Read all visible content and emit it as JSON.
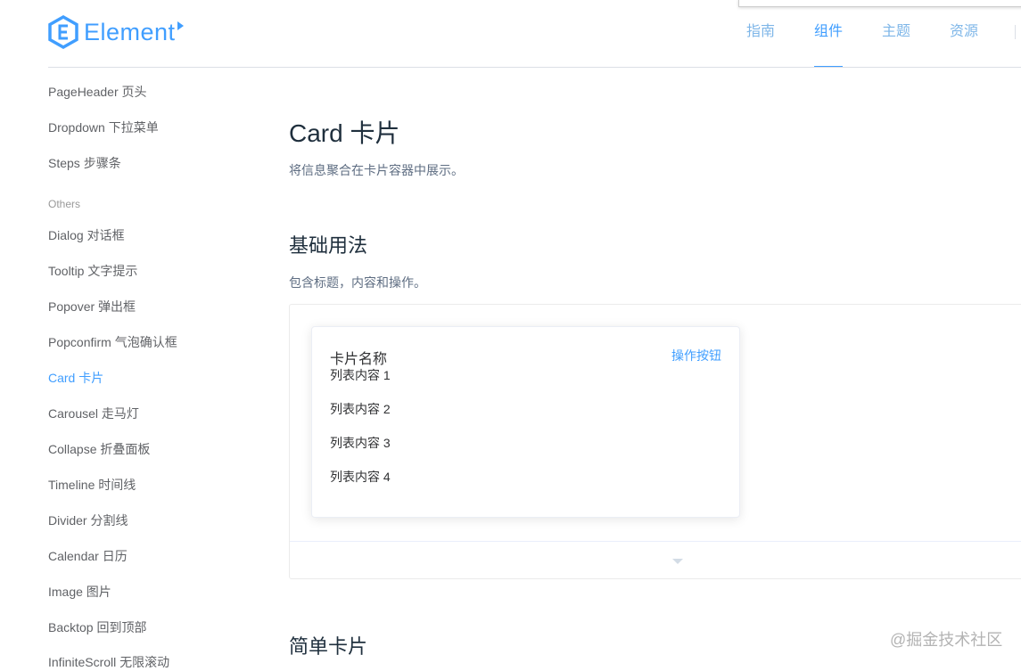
{
  "header": {
    "logo_text": "Element",
    "nav": [
      {
        "label": "指南",
        "active": false
      },
      {
        "label": "组件",
        "active": true
      },
      {
        "label": "主题",
        "active": false
      },
      {
        "label": "资源",
        "active": false
      }
    ]
  },
  "sidebar": {
    "items_top": [
      {
        "label": "PageHeader 页头"
      },
      {
        "label": "Dropdown 下拉菜单"
      },
      {
        "label": "Steps 步骤条"
      }
    ],
    "group_label": "Others",
    "items_others": [
      {
        "label": "Dialog 对话框"
      },
      {
        "label": "Tooltip 文字提示"
      },
      {
        "label": "Popover 弹出框"
      },
      {
        "label": "Popconfirm 气泡确认框"
      },
      {
        "label": "Card 卡片",
        "active": true
      },
      {
        "label": "Carousel 走马灯"
      },
      {
        "label": "Collapse 折叠面板"
      },
      {
        "label": "Timeline 时间线"
      },
      {
        "label": "Divider 分割线"
      },
      {
        "label": "Calendar 日历"
      },
      {
        "label": "Image 图片"
      },
      {
        "label": "Backtop 回到顶部"
      },
      {
        "label": "InfiniteScroll 无限滚动"
      }
    ]
  },
  "main": {
    "title": "Card 卡片",
    "description": "将信息聚合在卡片容器中展示。",
    "section1": {
      "title": "基础用法",
      "description": "包含标题，内容和操作。"
    },
    "card": {
      "title": "卡片名称",
      "action": "操作按钮",
      "items": [
        "列表内容 1",
        "列表内容 2",
        "列表内容 3",
        "列表内容 4"
      ]
    },
    "section2": {
      "title": "简单卡片"
    }
  },
  "watermark": "@掘金技术社区",
  "colors": {
    "accent": "#409eff",
    "text_primary": "#1f2f3d",
    "text_regular": "#606266"
  }
}
